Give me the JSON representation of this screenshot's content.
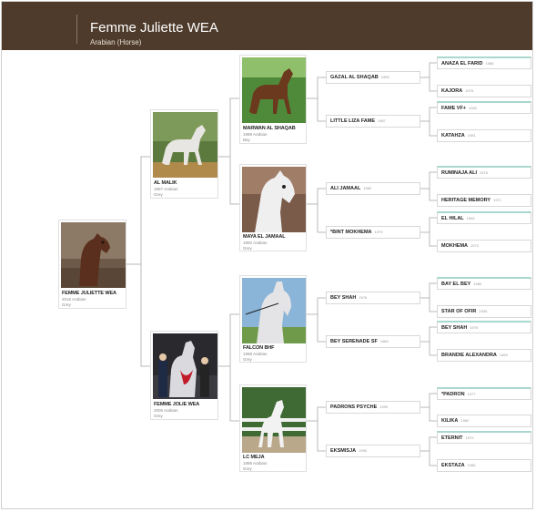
{
  "header": {
    "title": "Femme Juliette WEA",
    "subtitle": "Arabian (Horse)"
  },
  "colors": {
    "header_bg": "#4e3b2b",
    "accent": "#a8d8cf",
    "line": "#b9b9b9"
  },
  "subject": {
    "name": "FEMME JULIETTE WEA",
    "line1": "2016 Arabian",
    "line2": "Grey"
  },
  "gen1": [
    {
      "name": "AL MALIK",
      "line1": "1997 Arabian",
      "line2": "Grey"
    },
    {
      "name": "FEMME JOLIE WEA",
      "line1": "2006 Arabian",
      "line2": "Grey"
    }
  ],
  "gen2": [
    {
      "name": "MARWAN AL SHAQAB",
      "line1": "1998 Arabian",
      "line2": "Bay"
    },
    {
      "name": "MAYA EL JAMAAL",
      "line1": "1992 Arabian",
      "line2": "Grey"
    },
    {
      "name": "FALCON BHF",
      "line1": "1998 Arabian",
      "line2": "Grey"
    },
    {
      "name": "LC MEJA",
      "line1": "1998 Arabian",
      "line2": "Grey"
    }
  ],
  "gen3": [
    {
      "name": "GAZAL AL SHAQAB",
      "year": "1995"
    },
    {
      "name": "LITTLE LIZA FAME",
      "year": "1987"
    },
    {
      "name": "ALI JAMAAL",
      "year": "1982"
    },
    {
      "name": "*BINT MOKHEMA",
      "year": "1979"
    },
    {
      "name": "BEY SHAH",
      "year": "1976"
    },
    {
      "name": "BEY SERENADE SF",
      "year": "1989"
    },
    {
      "name": "PADRONS PSYCHE",
      "year": "1990"
    },
    {
      "name": "EKSMISJA",
      "year": "1990"
    }
  ],
  "gen4": [
    {
      "name": "ANAZA EL FARID",
      "year": "1986"
    },
    {
      "name": "KAJORA",
      "year": "1975"
    },
    {
      "name": "FAME VF+",
      "year": "1982"
    },
    {
      "name": "KATAHZA",
      "year": "1981"
    },
    {
      "name": "RUMINAJA ALI",
      "year": "1976"
    },
    {
      "name": "HERITAGE MEMORY",
      "year": "1971"
    },
    {
      "name": "EL HILAL",
      "year": "1965"
    },
    {
      "name": "MOKHEMA",
      "year": "1973"
    },
    {
      "name": "BAY EL BEY",
      "year": "1980"
    },
    {
      "name": "STAR OF OFIR",
      "year": "1935"
    },
    {
      "name": "BEY SHAH",
      "year": "1976"
    },
    {
      "name": "BRANDIE ALEXANDRA",
      "year": "1983"
    },
    {
      "name": "*PADRON",
      "year": "1977"
    },
    {
      "name": "KILIKA",
      "year": "1982"
    },
    {
      "name": "ETERNIT",
      "year": "1979"
    },
    {
      "name": "EKSTAZA",
      "year": "1986"
    }
  ]
}
